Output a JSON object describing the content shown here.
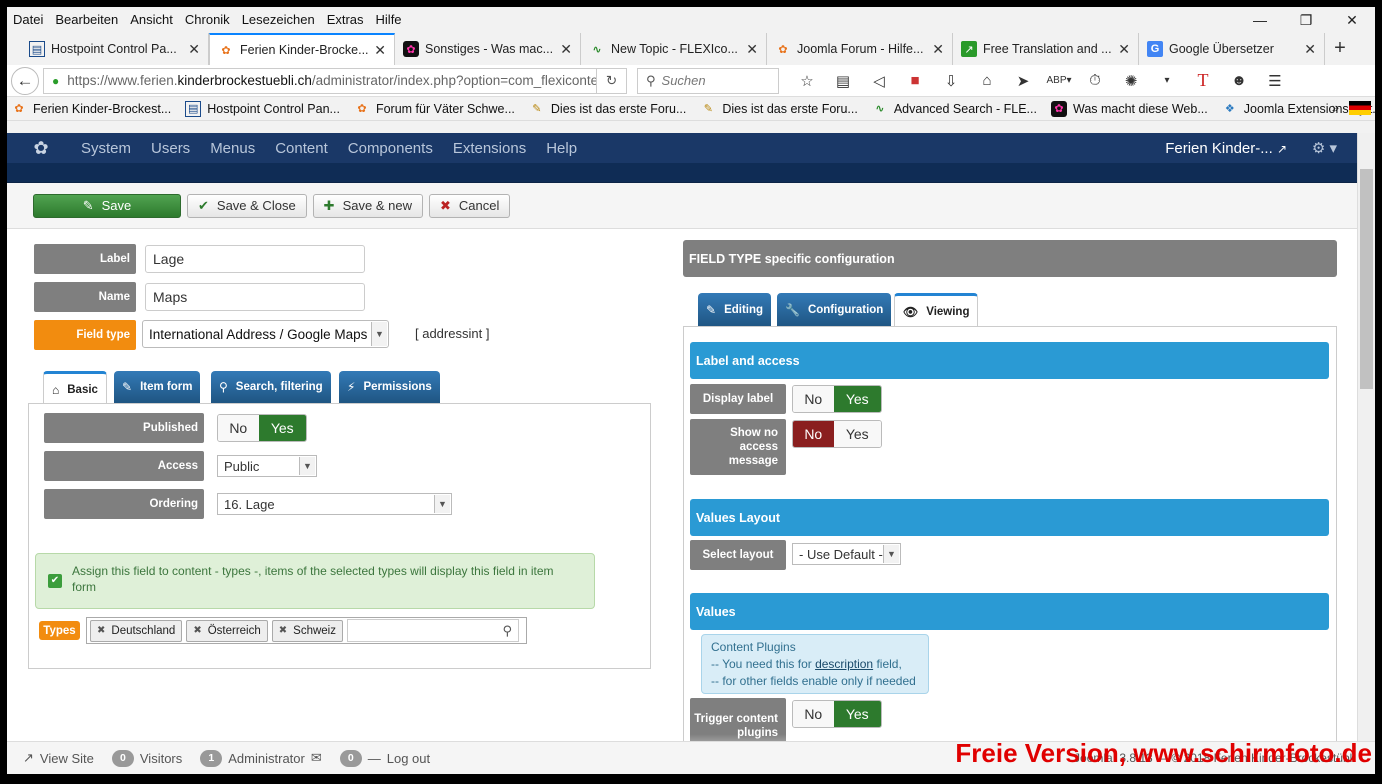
{
  "menubar": {
    "items": [
      "Datei",
      "Bearbeiten",
      "Ansicht",
      "Chronik",
      "Lesezeichen",
      "Extras",
      "Hilfe"
    ]
  },
  "tabs": [
    {
      "title": "Hostpoint Control Pa...",
      "icon": "page-icon"
    },
    {
      "title": "Ferien Kinder-Brocke...",
      "icon": "joomla-icon",
      "active": true
    },
    {
      "title": "Sonstiges - Was mac...",
      "icon": "joomla-icon"
    },
    {
      "title": "New Topic - FLEXIco...",
      "icon": "flexicontent-icon"
    },
    {
      "title": "Joomla Forum - Hilfe...",
      "icon": "joomla-icon"
    },
    {
      "title": "Free Translation and ...",
      "icon": "translate-icon"
    },
    {
      "title": "Google Übersetzer",
      "icon": "google-translate-icon"
    }
  ],
  "url": {
    "prefix": "https://www.ferien.",
    "domain": "kinderbrockestuebli.ch",
    "path": "/administrator/index.php?option=com_flexicontent"
  },
  "search": {
    "placeholder": "Suchen"
  },
  "bookmarks": [
    {
      "label": "Ferien Kinder-Brockest...",
      "icon": "joomla-icon"
    },
    {
      "label": "Hostpoint Control Pan...",
      "icon": "page-icon"
    },
    {
      "label": "Forum für Väter Schwe...",
      "icon": "joomla-icon"
    },
    {
      "label": "Dies ist das erste Foru...",
      "icon": "forum-icon"
    },
    {
      "label": "Dies ist das erste Foru...",
      "icon": "forum-icon"
    },
    {
      "label": "Advanced Search - FLE...",
      "icon": "flexicontent-icon"
    },
    {
      "label": "Was macht diese Web...",
      "icon": "joomla-icon"
    },
    {
      "label": "Joomla Extensions by t...",
      "icon": "extensions-icon"
    }
  ],
  "admin": {
    "nav": [
      "System",
      "Users",
      "Menus",
      "Content",
      "Components",
      "Extensions",
      "Help"
    ],
    "site_name": "Ferien Kinder-...",
    "toolbar": {
      "save": "Save",
      "save_close": "Save & Close",
      "save_new": "Save & new",
      "cancel": "Cancel"
    },
    "form": {
      "label_label": "Label",
      "label_value": "Lage",
      "name_label": "Name",
      "name_value": "Maps",
      "fieldtype_label": "Field type",
      "fieldtype_value": "International Address / Google Maps",
      "fieldtype_code": "[ addressint ]"
    },
    "left_tabs": {
      "basic": "Basic",
      "item_form": "Item form",
      "search": "Search, filtering",
      "permissions": "Permissions"
    },
    "basic": {
      "published_label": "Published",
      "no": "No",
      "yes": "Yes",
      "access_label": "Access",
      "access_value": "Public",
      "ordering_label": "Ordering",
      "ordering_value": "16. Lage",
      "assign_text": "Assign this field to content - types -, items of the selected types will display this field in item form",
      "types_label": "Types",
      "types": [
        "Deutschland",
        "Österreich",
        "Schweiz"
      ]
    },
    "right": {
      "header": "FIELD TYPE specific configuration",
      "tabs": {
        "editing": "Editing",
        "configuration": "Configuration",
        "viewing": "Viewing"
      },
      "label_access": "Label and access",
      "display_label": "Display label",
      "show_no_access": "Show no access message",
      "values_layout": "Values Layout",
      "select_layout": "Select layout",
      "select_layout_value": "- Use Default -",
      "values": "Values",
      "content_plugins": {
        "line1": "Content Plugins",
        "line2_pre": "-- You need this for ",
        "line2_link": "description",
        "line2_post": " field,",
        "line3": "-- for other fields enable only if needed"
      },
      "trigger": "Trigger content plugins",
      "no": "No",
      "yes": "Yes"
    },
    "footer": {
      "view_site": "View Site",
      "visitors_count": "0",
      "visitors": "Visitors",
      "admin_count": "1",
      "admin": "Administrator",
      "msg_count": "0",
      "logout": "Log out",
      "version": "Joomla! 3.8.13 — © 2018 Ferien Kinder-Brockestübli"
    }
  },
  "watermark": "Freie Version, www.schirmfoto.de"
}
